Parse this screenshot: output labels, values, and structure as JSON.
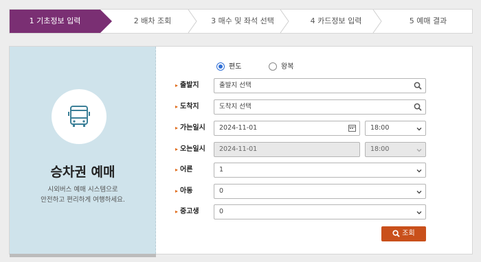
{
  "steps": [
    {
      "label": "1 기초정보 입력"
    },
    {
      "label": "2 배차 조회"
    },
    {
      "label": "3 매수 및 좌석 선택"
    },
    {
      "label": "4 카드정보 입력"
    },
    {
      "label": "5 예매 결과"
    }
  ],
  "intro": {
    "title": "승차권 예매",
    "subtitle_line1": "시외버스 예매 시스템으로",
    "subtitle_line2": "안전하고 편리하게 여행하세요."
  },
  "trip_type": {
    "one_way": "편도",
    "round_trip": "왕복",
    "selected": "편도"
  },
  "form": {
    "departure": {
      "label": "출발지",
      "placeholder": "출발지 선택"
    },
    "arrival": {
      "label": "도착지",
      "placeholder": "도착지 선택"
    },
    "depart_date": {
      "label": "가는일시",
      "date": "2024-11-01",
      "time": "18:00"
    },
    "return_date": {
      "label": "오는일시",
      "date": "2024-11-01",
      "time": "18:00"
    },
    "adult": {
      "label": "어른",
      "value": "1"
    },
    "child": {
      "label": "아동",
      "value": "0"
    },
    "youth": {
      "label": "중고생",
      "value": "0"
    }
  },
  "search_button": {
    "label": "조회"
  },
  "colors": {
    "active_step": "#7a2f73",
    "accent": "#c9501b",
    "radio": "#2f6fd6",
    "left_panel": "#cfe3eb"
  }
}
